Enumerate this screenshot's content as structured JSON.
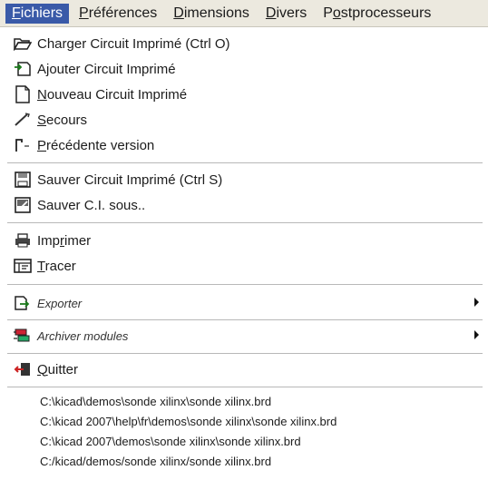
{
  "menubar": {
    "items": [
      {
        "first": "F",
        "rest": "ichiers"
      },
      {
        "first": "P",
        "rest": "références"
      },
      {
        "first": "D",
        "rest": "imensions"
      },
      {
        "first": "D",
        "rest": "ivers"
      },
      {
        "pre": "P",
        "first": "o",
        "rest": "stprocesseurs"
      }
    ]
  },
  "menu": {
    "charger": "Charger Circuit Imprimé (Ctrl O)",
    "ajouter": "Ajouter Circuit Imprimé",
    "nouveau": {
      "first": "N",
      "rest": "ouveau Circuit Imprimé"
    },
    "secours": {
      "first": "S",
      "rest": "ecours"
    },
    "precedente": {
      "first": "P",
      "rest": "récédente version"
    },
    "sauver": "Sauver Circuit Imprimé (Ctrl S)",
    "sauver_sous": "Sauver C.I. sous..",
    "imprimer": {
      "pre": "Imp",
      "first": "r",
      "rest": "imer"
    },
    "tracer": {
      "first": "T",
      "rest": "racer"
    },
    "exporter": "Exporter",
    "archiver": "Archiver modules",
    "quitter": {
      "first": "Q",
      "rest": "uitter"
    }
  },
  "recent_files": [
    "C:\\kicad\\demos\\sonde xilinx\\sonde xilinx.brd",
    "C:\\kicad 2007\\help\\fr\\demos\\sonde xilinx\\sonde xilinx.brd",
    "C:\\kicad 2007\\demos\\sonde xilinx\\sonde xilinx.brd",
    "C:/kicad/demos/sonde xilinx/sonde xilinx.brd"
  ]
}
